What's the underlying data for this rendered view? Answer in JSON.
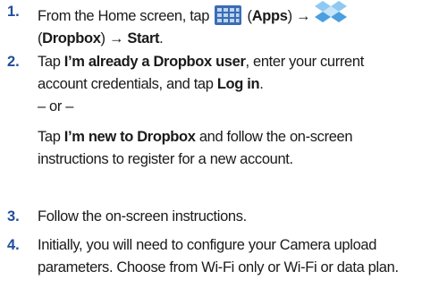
{
  "steps": [
    {
      "number": "1.",
      "part1": "From the Home screen, tap",
      "part2": "(",
      "apps_label": "Apps",
      "part3": ") ",
      "arrow1": "→",
      "line2_open": "(",
      "dropbox_label": "Dropbox",
      "line2_close": ") ",
      "arrow2": "→",
      "start_label": "Start",
      "end": "."
    },
    {
      "number": "2.",
      "tap": "Tap ",
      "already_user": "I’m already a Dropbox user",
      "middle": ", enter your current account credentials, and tap ",
      "log_in": "Log in",
      "end": ".",
      "or": "– or –",
      "tap2": "Tap ",
      "new_user": "I’m new to Dropbox",
      "rest": " and follow the on-screen instructions to register for a new account."
    },
    {
      "number": "3.",
      "text": "Follow the on-screen instructions."
    },
    {
      "number": "4.",
      "text": "Initially, you will need to configure your Camera upload parameters. Choose from Wi-Fi only or Wi-Fi or data plan."
    }
  ],
  "icons": {
    "apps": "apps-grid-icon",
    "dropbox": "dropbox-icon"
  },
  "colors": {
    "step_number": "#1f4e9c",
    "apps_icon_bg": "#3b6db3",
    "apps_icon_cell": "#bcd6f2",
    "dropbox_light": "#8fc9f2",
    "dropbox_dark": "#4a9fe0"
  }
}
